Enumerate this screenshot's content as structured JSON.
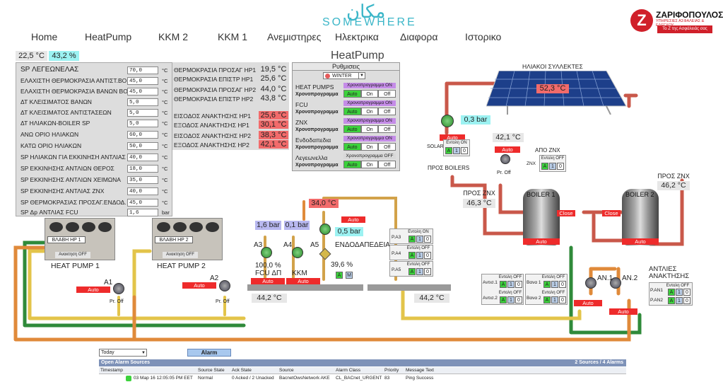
{
  "header": {
    "brand_ar": "مكان",
    "brand": "SOMEWHERE",
    "nav": [
      "Home",
      "HeatPump",
      "ΚΚΜ 2",
      "ΚΚΜ 1",
      "Ανεμιστηρες",
      "Ηλεκτρικα",
      "Διαφορα",
      "Ιστορικο"
    ],
    "logo_letter": "Z",
    "logo_name": "ΖΑΡΙΦΟΠΟΥΛΟΣ",
    "logo_sub": "ΥΠΗΡΕΣΙΕΣ ΑΣΦΑΛΕΙΑΣ & ΕΛΕΓΧΟΥ",
    "logo_tag": "Το Ζ της Ασφάλειάς σας"
  },
  "outdoor": {
    "temp": "22,5 °C",
    "humidity": "43,2 %"
  },
  "page_title": "HeatPump",
  "setpoints": [
    {
      "label": "SP ΛΕΓΕΩΝΕΛΑΣ",
      "value": "70,0",
      "unit": "°C"
    },
    {
      "label": "ΕΛΑΧΙΣΤΗ ΘΕΡΜΟΚΡΑΣΙΑ ΑΝΤΙΣΤ.BOILER",
      "value": "45,0",
      "unit": "°C"
    },
    {
      "label": "ΕΛΑΧΙΣΤΗ ΘΕΡΜΟΚΡΑΣΙΑ ΒΑΝΩΝ BOILER",
      "value": "45,0",
      "unit": "°C"
    },
    {
      "label": "ΔΤ ΚΛΕΙΣΙΜΑΤΟΣ ΒΑΝΩΝ",
      "value": "5,0",
      "unit": "°C"
    },
    {
      "label": "ΔΤ ΚΛΕΙΣΙΜΑΤΟΣ ΑΝΤΙΣΤΑΣΕΩΝ",
      "value": "5,0",
      "unit": "°C"
    },
    {
      "label": "ΔΤ ΗΛΙΑΚΩΝ-BOILER SP",
      "value": "5,0",
      "unit": "°C"
    },
    {
      "label": "ΑΝΩ ΟΡΙΟ ΗΛΙΑΚΩΝ",
      "value": "60,0",
      "unit": "°C"
    },
    {
      "label": "ΚΑΤΩ ΟΡΙΟ ΗΛΙΑΚΩΝ",
      "value": "50,0",
      "unit": "°C"
    },
    {
      "label": "SP ΗΛΙΑΚΩΝ ΓΙΑ ΕΚΚΙΝΗΣΗ ΑΝΤΛΙΑΣ",
      "value": "40,0",
      "unit": "°C"
    },
    {
      "label": "SP ΕΚΚΙΝΗΣΗΣ ΑΝΤΛΙΩΝ ΘΕΡΟΣ",
      "value": "18,0",
      "unit": "°C"
    },
    {
      "label": "SP ΕΚΚΙΝΗΣΗΣ ΑΝΤΛΙΩΝ ΧΕΙΜΩΝΑ",
      "value": "35,0",
      "unit": "°C"
    },
    {
      "label": "SP ΕΚΚΙΝΗΣΗΣ ΑΝΤΛΙΑΣ ΖΝΧ",
      "value": "40,0",
      "unit": "°C"
    },
    {
      "label": "SP ΘΕΡΜΟΚΡΑΣΙΑΣ ΠΡΟΣΑΓ.ΕΝΔΟΔ.",
      "value": "45,0",
      "unit": "°C"
    },
    {
      "label": "SP Δp ΑΝΤΛΙΑΣ FCU",
      "value": "1,6",
      "unit": "bar"
    }
  ],
  "hp_temps": [
    {
      "label": "ΘΕΡΜΟΚΡΑΣΙΑ ΠΡΟΣΑΓ HP1",
      "value": "19,5 °C"
    },
    {
      "label": "ΘΕΡΜΟΚΡΑΣΙΑ ΕΠΙΣΤΡ HP1",
      "value": "25,6 °C"
    },
    {
      "label": "ΘΕΡΜΟΚΡΑΣΙΑ ΠΡΟΣΑΓ HP2",
      "value": "44,0 °C"
    },
    {
      "label": "ΘΕΡΜΟΚΡΑΣΙΑ ΕΠΙΣΤΡ HP2",
      "value": "43,8 °C"
    },
    {
      "label": "ΕΙΣΟΔΟΣ ΑΝΑΚΤΗΣΗΣ HP1",
      "value": "25,6 °C"
    },
    {
      "label": "ΕΞΟΔΟΣ ΑΝΑΚΤΗΣΗΣ HP1",
      "value": "30,1 °C"
    },
    {
      "label": "ΕΙΣΟΔΟΣ ΑΝΑΚΤΗΣΗΣ HP2",
      "value": "38,3 °C"
    },
    {
      "label": "ΕΞΟΔΟΣ ΑΝΑΚΤΗΣΗΣ HP2",
      "value": "42,1 °C"
    }
  ],
  "settings": {
    "title": "Ρυθμισεις",
    "mode": "WINTER",
    "sched_label": "Χρονοπρογραμμα",
    "sched_on": "Χρονοπρογραμμα ON",
    "sched_off": "Χρονοπρογραμμα OFF",
    "auto": "Auto",
    "on": "On",
    "off": "Off",
    "groups": [
      "HEAT PUMPS",
      "FCU",
      "ZNX",
      "Ενδοδαπεδια",
      "Λεγεωνελλα"
    ]
  },
  "solar": {
    "title": "ΗΛΙΑΚΟΙ ΣΥΛΛΕΚΤΕΣ",
    "temp": "52,3 °C",
    "pressure": "0,3 bar",
    "auto": "Auto",
    "label": "SOLAR",
    "cmd": "Εντολη ON",
    "a": "A",
    "one": "1",
    "zero": "0",
    "to_boilers": "ΠΡΟΣ BOILERS",
    "temp2": "42,1 °C",
    "auto2": "Auto",
    "pr_off": "Pr. Off"
  },
  "znx": {
    "from": "ΑΠΟ ZNX",
    "cmd": "Εντολη OFF",
    "label": "ZNX",
    "to1": "ΠΡΟΣ ZNX",
    "to1_temp": "46,3 °C",
    "to2": "ΠΡΟΣ ZNX",
    "to2_temp": "46,2 °C"
  },
  "boilers": {
    "b1": "BOILER 1",
    "b2": "BOILER 2",
    "auto": "Auto",
    "valve": "Close",
    "pumps_title": "ΑΝΤΛΙΕΣ ΑΝΑΚΤΗΣΗΣ",
    "an1": "ΑΝ.1",
    "an2": "ΑΝ.2",
    "pan1": "P.AN1",
    "pan2": "P.AN2",
    "cmd_off": "Εντολη OFF",
    "antis1": "Αντισ.1",
    "antis2": "Αντισ.2",
    "vana1": "Βανα 1",
    "vana2": "Βανα 2"
  },
  "heatpumps": {
    "hp1": "HEAT PUMP 1",
    "hp2": "HEAT PUMP 2",
    "fault1": "ΒΛΑΒΗ ΗΡ 1",
    "fault2": "ΒΛΑΒΗ ΗΡ 2",
    "recov": "Ανακτηση OFF",
    "a1": "A1",
    "a2": "A2",
    "auto": "Auto",
    "pr_off": "Pr. Off"
  },
  "circuits": {
    "a3_bar": "1,6 bar",
    "a4_bar": "0,1 bar",
    "a3": "A3",
    "a4": "A4",
    "a5": "A5",
    "a3_pct": "100,0 %",
    "a3_name": "FCU ΔΠ",
    "a4_name": "KKM",
    "a5_name": "ΕΝΔΟΔΑΠΕΔΕΙΑ",
    "a5_temp": "34,0 °C",
    "a5_bar": "0,5 bar",
    "a5_pct": "39,6 %",
    "auto": "Auto",
    "a": "A",
    "m": "M",
    "header_temp1": "44,2 °C",
    "header_temp2": "44,2 °C",
    "pa3": "P.A3",
    "pa4": "P.A4",
    "pa5": "P.A5",
    "cmd_on": "Εντολη ON",
    "cmd_off": "Εντολη OFF"
  },
  "alarm": {
    "filter": "Today",
    "button": "Alarm",
    "bar_left": "Open Alarm Sources",
    "bar_right": "2 Sources / 4 Alarms",
    "columns": [
      "Timestamp",
      "Source State",
      "Ack State",
      "Source",
      "Alarm Class",
      "Priority",
      "Message Text"
    ],
    "row": [
      "03 Map 16 12:05:05 PM EET",
      "Normal",
      "0 Acked / 2 Unacked",
      "BacnetOwsNetwork AKE",
      "CL_BACnet_URGENT",
      "83",
      "Ping Success"
    ]
  },
  "colors": {
    "accent": "#3bb6c8",
    "alarm_red": "#ee2b2b",
    "ok_green": "#3cd23c",
    "pipe_red": "#c9584a",
    "pipe_green": "#2f8a3a",
    "pipe_yellow": "#e3c44a",
    "pipe_orange": "#e08a3a"
  }
}
